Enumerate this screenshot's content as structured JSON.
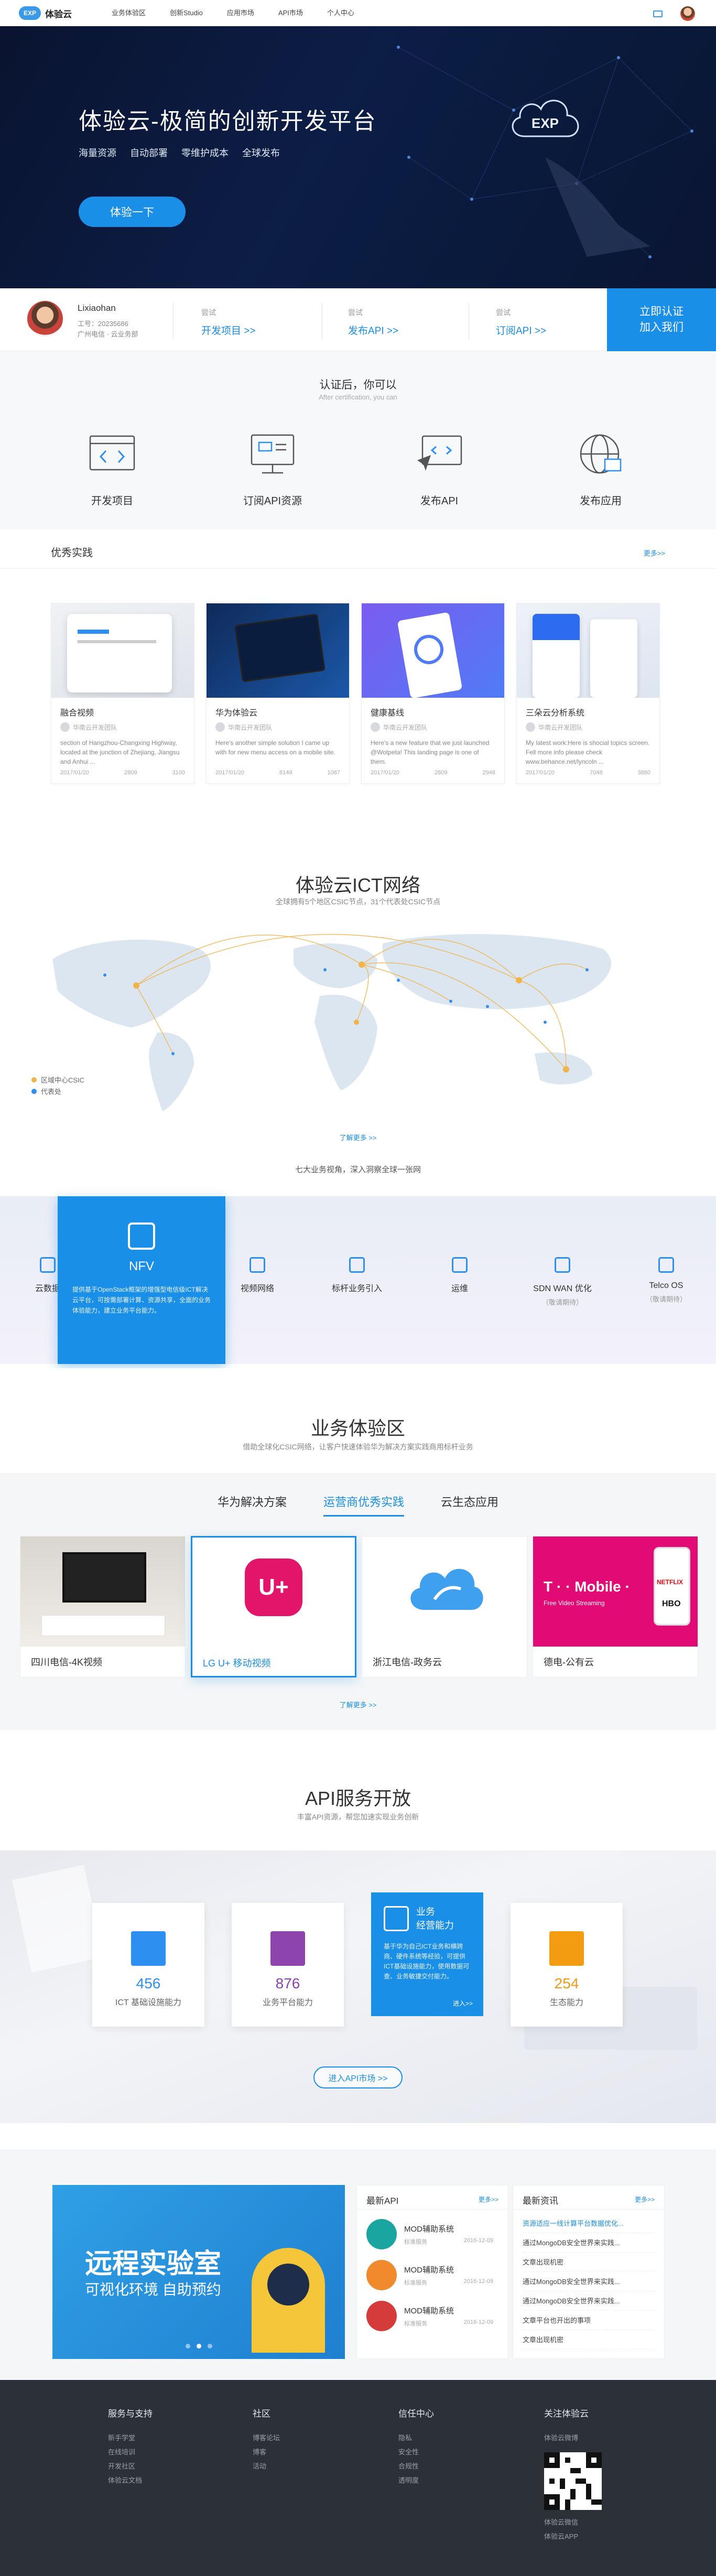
{
  "nav": {
    "logo_mark": "EXP",
    "logo_name": "体验云",
    "items": [
      "业务体验区",
      "创新Studio",
      "应用市场",
      "API市场",
      "个人中心"
    ]
  },
  "hero": {
    "title": "体验云-极简的创新开发平台",
    "subtitle": [
      "海量资源",
      "自动部署",
      "零维护成本",
      "全球发布"
    ],
    "cta": "体验一下",
    "cloud_label": "EXP"
  },
  "profile": {
    "name": "Lixiaohan",
    "info_line1": "工号：20235686",
    "info_line2": "广州电信 · 云业务部",
    "col1_title": "尝试",
    "col1_link": "开发项目 >>",
    "col2_title": "尝试",
    "col2_link": "发布API >>",
    "col3_title": "尝试",
    "col3_link": "订阅API >>",
    "join_line1": "立即认证",
    "join_line2": "加入我们"
  },
  "cert": {
    "title": "认证后，你可以",
    "subtitle": "After certification, you can",
    "items": [
      "开发项目",
      "订阅API资源",
      "发布API",
      "发布应用"
    ]
  },
  "practice": {
    "title": "优秀实践",
    "more": "更多>>",
    "cards": [
      {
        "title": "融合视频",
        "author": "华南云开发团队",
        "desc": "section of Hangzhou-Changxing Highway, located at the junction of Zhejiang, Jiangsu and Anhui ...",
        "date": "2017/01/20",
        "views": "2809",
        "likes": "3100"
      },
      {
        "title": "华为体验云",
        "author": "华南云开发团队",
        "desc": "Here's another simple solution I came up with for new menu access on a mobile site.",
        "date": "2017/01/20",
        "views": "8149",
        "likes": "1087"
      },
      {
        "title": "健康基线",
        "author": "华南云开发团队",
        "desc": "Here's a new feature that we just launched @Wotpeta! This landing page is one of them.",
        "date": "2017/01/20",
        "views": "2809",
        "likes": "2948"
      },
      {
        "title": "三朵云分析系统",
        "author": "华南云开发团队",
        "desc": "My latest work:Here is shocial topics screen. Fell more info please check www.behance.net/lyncoln ...",
        "date": "2017/01/20",
        "views": "7048",
        "likes": "3880"
      }
    ]
  },
  "ict": {
    "title": "体验云ICT网络",
    "subtitle": "全球拥有5个地区CSIC节点，31个代表处CSIC节点",
    "legend": [
      "区域中心CSIC",
      "代表处"
    ],
    "more": "了解更多 >>",
    "seven": "七大业务视角，深入洞察全球一张网",
    "tiles": [
      {
        "label": "云数据",
        "sub": ""
      },
      {
        "label": "视频网络",
        "sub": ""
      },
      {
        "label": "标杆业务引入",
        "sub": ""
      },
      {
        "label": "运维",
        "sub": ""
      },
      {
        "label": "SDN WAN 优化",
        "sub": "（敬请期待）"
      },
      {
        "label": "Telco OS",
        "sub": "（敬请期待）"
      }
    ],
    "active": {
      "label": "NFV",
      "desc": "提供基于OpenStack框架的增强型电信级ICT解决云平台，可按需部署计算、资源共享，全面的业务体验能力，建立业务平台能力。"
    }
  },
  "biz": {
    "title": "业务体验区",
    "subtitle": "借助全球化CSIC网络，让客户快速体验华为解决方案实践商用标杆业务",
    "tabs": [
      "华为解决方案",
      "运营商优秀实践",
      "云生态应用"
    ],
    "more": "了解更多 >>",
    "cards": [
      "四川电信-4K视频",
      "LG U+ 移动视频",
      "浙江电信-政务云",
      "德电-公有云"
    ],
    "lgu_mark": "U+",
    "tmobile_text": "T · · Mobile ·",
    "tmobile_sub": "Free Video Streaming",
    "netflix": "NETFLIX",
    "hbo": "HBO"
  },
  "api": {
    "title": "API服务开放",
    "subtitle": "丰富API资源，帮您加速实现业务创新",
    "cards": [
      {
        "number": "456",
        "label": "ICT 基础设施能力",
        "color": "#2d8ff0"
      },
      {
        "number": "876",
        "label": "业务平台能力",
        "color": "#8e44ad"
      },
      {
        "number": "254",
        "label": "生态能力",
        "color": "#f39c12"
      }
    ],
    "active": {
      "title1": "业务",
      "title2": "经营能力",
      "desc": "基于华为自己ICT业务和横跨商、硬件系统等经验，可提供ICT基础设施能力，使用数据可查、业务敏捷交付能力。",
      "enter": "进入>>"
    },
    "btn": "进入API市场 >>"
  },
  "lab": {
    "line1": "远程实验室",
    "line2": "可视化环境 自助预约"
  },
  "latest_api": {
    "title": "最新API",
    "more": "更多>>",
    "items": [
      {
        "name": "MOD辅助系统",
        "owner": "标准服务",
        "date": "2016-12-09",
        "color": "#1aa5a0"
      },
      {
        "name": "MOD辅助系统",
        "owner": "标准服务",
        "date": "2016-12-09",
        "color": "#f08a2c"
      },
      {
        "name": "MOD辅助系统",
        "owner": "标准服务",
        "date": "2016-12-09",
        "color": "#d63b3b"
      }
    ]
  },
  "latest_news": {
    "title": "最新资讯",
    "more": "更多>>",
    "items": [
      "资源适应一线计算平台数据优化...",
      "通过MongoDB安全世界来实践...",
      "文章出现机密",
      "通过MongoDB安全世界来实践...",
      "通过MongoDB安全世界来实践...",
      "文章平台也开出的事项",
      "文章出现机密"
    ]
  },
  "footer": {
    "cols": [
      {
        "title": "服务与支持",
        "links": [
          "新手学堂",
          "在线培训",
          "开发社区",
          "体验云文档"
        ]
      },
      {
        "title": "社区",
        "links": [
          "博客论坛",
          "博客",
          "活动"
        ]
      },
      {
        "title": "信任中心",
        "links": [
          "隐私",
          "安全性",
          "合规性",
          "透明度"
        ]
      }
    ],
    "follow": {
      "title": "关注体验云",
      "top": "体验云微博",
      "bottom1": "体验云微信",
      "bottom2": "体验云APP"
    }
  }
}
